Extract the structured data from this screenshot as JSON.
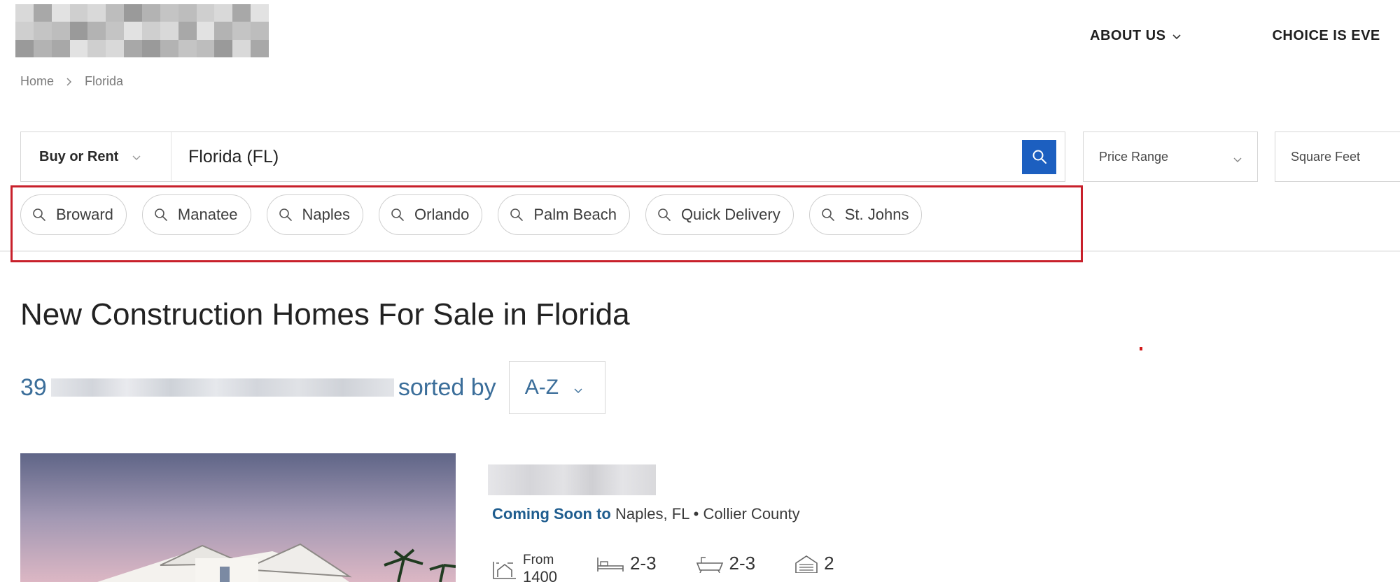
{
  "nav": {
    "items": [
      {
        "label": "ABOUT US",
        "has_dropdown": true
      },
      {
        "label": "CHOICE IS EVE",
        "has_dropdown": false
      }
    ]
  },
  "breadcrumb": {
    "items": [
      "Home",
      "Florida"
    ]
  },
  "search": {
    "mode_label": "Buy or Rent",
    "location_value": "Florida (FL)",
    "search_icon": "search-icon",
    "accent_color": "#1c5fc0"
  },
  "filters": {
    "price_range": "Price Range",
    "square_feet": "Square Feet"
  },
  "quick_chips": [
    "Broward",
    "Manatee",
    "Naples",
    "Orlando",
    "Palm Beach",
    "Quick Delivery",
    "St. Johns"
  ],
  "highlight_color": "#c8202b",
  "page": {
    "title": "New Construction Homes For Sale in Florida",
    "result_count": "39",
    "sorted_by_label": "sorted by",
    "sort_value": "A-Z"
  },
  "listing": {
    "status_label": "Coming Soon to",
    "location": "Naples, FL • Collier County",
    "from_label": "From",
    "sqft_value": "1400",
    "beds": "2-3",
    "baths": "2-3",
    "garage": "2",
    "status_color": "#1f5d8f"
  }
}
